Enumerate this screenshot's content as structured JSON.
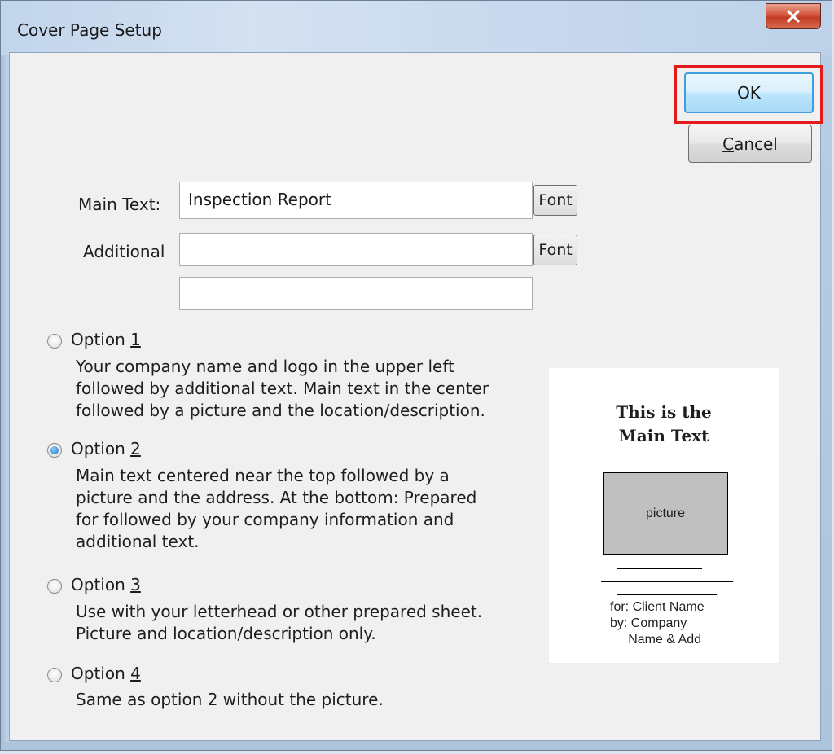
{
  "window": {
    "title": "Cover Page Setup"
  },
  "buttons": {
    "ok": "OK",
    "cancel_mnemonic": "C",
    "cancel_rest": "ancel",
    "font1": "Font",
    "font2": "Font"
  },
  "fields": {
    "main_text_label": "Main Text:",
    "main_text_value": "Inspection Report",
    "additional_label": "Additional",
    "additional_value": "",
    "additional2_value": ""
  },
  "options": [
    {
      "prefix": "Option ",
      "key": "1",
      "selected": false,
      "desc": [
        "Your company name and logo in the upper left",
        "followed by additional text. Main text in the center",
        "followed by a picture and the location/description."
      ]
    },
    {
      "prefix": "Option ",
      "key": "2",
      "selected": true,
      "desc": [
        "Main text centered near the top followed by a",
        "picture and the address. At the bottom: Prepared",
        "for followed by your company information and",
        "additional text."
      ]
    },
    {
      "prefix": "Option ",
      "key": "3",
      "selected": false,
      "desc": [
        "Use with your letterhead or other prepared sheet.",
        "Picture and location/description only."
      ]
    },
    {
      "prefix": "Option ",
      "key": "4",
      "selected": false,
      "desc": [
        "Same as option 2 without the picture."
      ]
    }
  ],
  "preview": {
    "title_line1": "This is the",
    "title_line2": "Main Text",
    "picture_label": "picture",
    "meta_line1": "for: Client Name",
    "meta_line2": "by: Company",
    "meta_line3": "     Name & Add"
  },
  "colors": {
    "highlight": "#e41b1b",
    "ok_border": "#3c9ee0",
    "close_red": "#c23a22"
  },
  "icons": {
    "close": "close-icon"
  }
}
